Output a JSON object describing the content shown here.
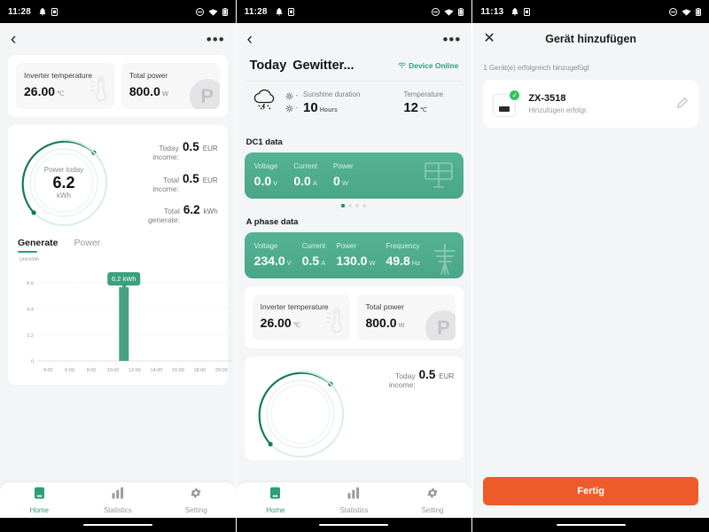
{
  "panel1": {
    "statusbar": {
      "time": "11:28",
      "icons": [
        "bell-icon",
        "sim-icon",
        "dnd-icon",
        "wifi-icon",
        "battery-icon"
      ]
    },
    "nav": {
      "back": "‹",
      "menu": "•••"
    },
    "tiles": [
      {
        "label": "Inverter temperature",
        "value": "26.00",
        "unit": "℃",
        "icon": "thermometer-icon"
      },
      {
        "label": "Total power",
        "value": "800.0",
        "unit": "W",
        "icon": "power-p-icon"
      }
    ],
    "gauge": {
      "caption": "Power today",
      "value": "6.2",
      "unit": "kWh",
      "percent": 72
    },
    "income": [
      {
        "label": "Today income:",
        "value": "0.5",
        "unit": "EUR"
      },
      {
        "label": "Total income:",
        "value": "0.5",
        "unit": "EUR"
      },
      {
        "label": "Total generate:",
        "value": "6.2",
        "unit": "kWh"
      }
    ],
    "tabs": [
      {
        "label": "Generate",
        "active": true
      },
      {
        "label": "Power",
        "active": false
      }
    ],
    "chart_unit_label": "Unit:kWh",
    "tooltip": "6.2 kWh",
    "bottomnav": [
      {
        "label": "Home",
        "icon": "home-icon",
        "active": true
      },
      {
        "label": "Statistics",
        "icon": "bars-icon",
        "active": false
      },
      {
        "label": "Setting",
        "icon": "gear-icon",
        "active": false
      }
    ]
  },
  "chart_data": {
    "type": "bar",
    "title": "",
    "subtitle": "",
    "xlabel": "",
    "ylabel": "Unit:kWh",
    "categories": [
      "4:00",
      "6:00",
      "8:00",
      "10:00",
      "12:00",
      "14:00",
      "16:00",
      "18:00",
      "20:00"
    ],
    "xticks": [
      "4:00",
      "6:00",
      "8:00",
      "10:00",
      "12:00",
      "14:00",
      "16:00",
      "18:00",
      "20:00"
    ],
    "yticks": [
      0,
      2.2,
      4.4,
      6.6
    ],
    "ylim": [
      0,
      7.3
    ],
    "grid": true,
    "legend": "none",
    "bar_color": "#46a283",
    "series": [
      {
        "name": "Generate",
        "points": [
          {
            "x": "4:00",
            "y": 0
          },
          {
            "x": "6:00",
            "y": 0
          },
          {
            "x": "8:00",
            "y": 0
          },
          {
            "x": "10:00",
            "y": 0
          },
          {
            "x": "11:00",
            "y": 6.2
          },
          {
            "x": "12:00",
            "y": 0
          },
          {
            "x": "14:00",
            "y": 0
          },
          {
            "x": "16:00",
            "y": 0
          },
          {
            "x": "18:00",
            "y": 0
          },
          {
            "x": "20:00",
            "y": 0
          }
        ]
      }
    ],
    "annotations": [
      {
        "text": "6.2 kWh",
        "x": "11:00",
        "y": 6.2
      }
    ]
  },
  "panel2": {
    "statusbar": {
      "time": "11:28"
    },
    "header": {
      "today": "Today",
      "condition": "Gewitter...",
      "status": "Device Online",
      "status_icon": "wifi-icon"
    },
    "weather": {
      "icon": "thunderstorm-cloud-icon",
      "sunrise": "-",
      "sunset": "-",
      "sunshine_label": "Sunshine duration",
      "sunshine_value": "10",
      "sunshine_unit": "Hours",
      "temp_label": "Temperature",
      "temp_value": "12",
      "temp_unit": "℃"
    },
    "dc1": {
      "heading": "DC1 data",
      "icon": "solar-panel-icon",
      "items": [
        {
          "label": "Voltage",
          "value": "0.0",
          "unit": "V"
        },
        {
          "label": "Current",
          "value": "0.0",
          "unit": "A"
        },
        {
          "label": "Power",
          "value": "0",
          "unit": "W"
        }
      ],
      "pager": {
        "count": 4,
        "active": 0
      }
    },
    "aphase": {
      "heading": "A phase data",
      "icon": "power-pole-icon",
      "items": [
        {
          "label": "Voltage",
          "value": "234.0",
          "unit": "V"
        },
        {
          "label": "Current",
          "value": "0.5",
          "unit": "A"
        },
        {
          "label": "Power",
          "value": "130.0",
          "unit": "W"
        },
        {
          "label": "Frequency",
          "value": "49.8",
          "unit": "Hz"
        }
      ]
    },
    "tiles": [
      {
        "label": "Inverter temperature",
        "value": "26.00",
        "unit": "℃",
        "icon": "thermometer-icon"
      },
      {
        "label": "Total power",
        "value": "800.0",
        "unit": "W",
        "icon": "power-p-icon"
      }
    ],
    "income_peek": {
      "label": "Today income:",
      "value": "0.5",
      "unit": "EUR"
    },
    "bottomnav": [
      {
        "label": "Home",
        "icon": "home-icon",
        "active": true
      },
      {
        "label": "Statistics",
        "icon": "bars-icon",
        "active": false
      },
      {
        "label": "Setting",
        "icon": "gear-icon",
        "active": false
      }
    ]
  },
  "panel3": {
    "statusbar": {
      "time": "11:13"
    },
    "nav": {
      "close": "✕",
      "title": "Gerät hinzufügen"
    },
    "note": "1 Gerät(e) erfolgreich hinzugefügt",
    "device": {
      "name": "ZX-3518",
      "status": "Hinzufügen erfolgr.",
      "icon": "plug-adapter-icon",
      "badge": "check-icon",
      "edit_icon": "pencil-icon"
    },
    "button": {
      "label": "Fertig",
      "color": "#ee5b2b"
    }
  }
}
